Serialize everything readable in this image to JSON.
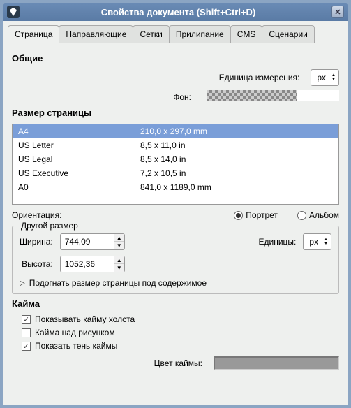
{
  "window": {
    "title": "Свойства документа (Shift+Ctrl+D)"
  },
  "tabs": [
    "Страница",
    "Направляющие",
    "Сетки",
    "Прилипание",
    "CMS",
    "Сценарии"
  ],
  "general": {
    "title": "Общие",
    "unit_label": "Единица измерения:",
    "unit_value": "px",
    "bg_label": "Фон:"
  },
  "pagesize": {
    "title": "Размер страницы",
    "rows": [
      {
        "name": "A4",
        "dim": "210,0 x 297,0 mm",
        "selected": true
      },
      {
        "name": "US Letter",
        "dim": "8,5 x 11,0 in",
        "selected": false
      },
      {
        "name": "US Legal",
        "dim": "8,5 x 14,0 in",
        "selected": false
      },
      {
        "name": "US Executive",
        "dim": "7,2 x 10,5 in",
        "selected": false
      },
      {
        "name": "A0",
        "dim": "841,0 x 1189,0 mm",
        "selected": false
      }
    ],
    "orient_label": "Ориентация:",
    "portrait": "Портрет",
    "landscape": "Альбом",
    "custom_legend": "Другой размер",
    "width_label": "Ширина:",
    "width_value": "744,09",
    "height_label": "Высота:",
    "height_value": "1052,36",
    "units_label": "Единицы:",
    "units_value": "px",
    "fit_label": "Подогнать размер страницы под содержимое"
  },
  "border": {
    "title": "Кайма",
    "show_border": "Показывать кайму холста",
    "border_on_top": "Кайма над рисунком",
    "show_shadow": "Показать тень каймы",
    "color_label": "Цвет каймы:"
  }
}
